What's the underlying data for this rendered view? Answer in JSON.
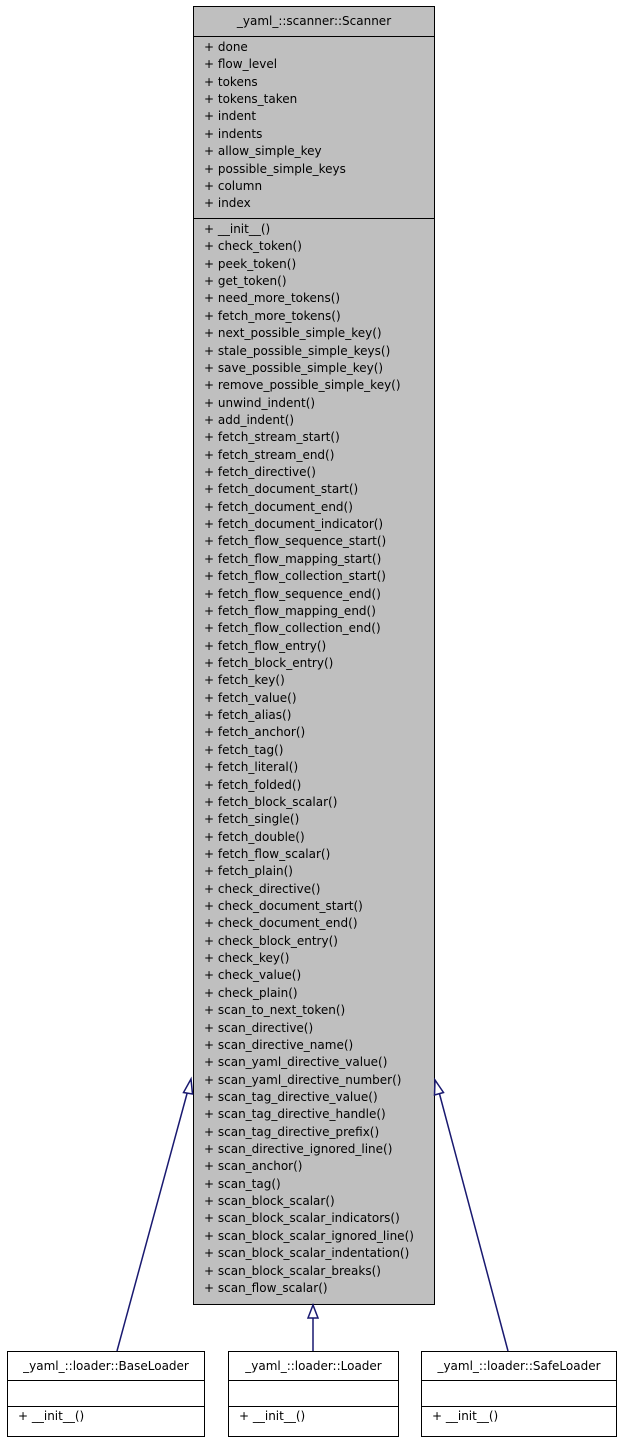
{
  "diagram": {
    "type": "uml-class-inheritance",
    "base_class": {
      "name": "_yaml_::scanner::Scanner",
      "attributes": [
        "+ done",
        "+ flow_level",
        "+ tokens",
        "+ tokens_taken",
        "+ indent",
        "+ indents",
        "+ allow_simple_key",
        "+ possible_simple_keys",
        "+ column",
        "+ index"
      ],
      "methods": [
        "+ __init__()",
        "+ check_token()",
        "+ peek_token()",
        "+ get_token()",
        "+ need_more_tokens()",
        "+ fetch_more_tokens()",
        "+ next_possible_simple_key()",
        "+ stale_possible_simple_keys()",
        "+ save_possible_simple_key()",
        "+ remove_possible_simple_key()",
        "+ unwind_indent()",
        "+ add_indent()",
        "+ fetch_stream_start()",
        "+ fetch_stream_end()",
        "+ fetch_directive()",
        "+ fetch_document_start()",
        "+ fetch_document_end()",
        "+ fetch_document_indicator()",
        "+ fetch_flow_sequence_start()",
        "+ fetch_flow_mapping_start()",
        "+ fetch_flow_collection_start()",
        "+ fetch_flow_sequence_end()",
        "+ fetch_flow_mapping_end()",
        "+ fetch_flow_collection_end()",
        "+ fetch_flow_entry()",
        "+ fetch_block_entry()",
        "+ fetch_key()",
        "+ fetch_value()",
        "+ fetch_alias()",
        "+ fetch_anchor()",
        "+ fetch_tag()",
        "+ fetch_literal()",
        "+ fetch_folded()",
        "+ fetch_block_scalar()",
        "+ fetch_single()",
        "+ fetch_double()",
        "+ fetch_flow_scalar()",
        "+ fetch_plain()",
        "+ check_directive()",
        "+ check_document_start()",
        "+ check_document_end()",
        "+ check_block_entry()",
        "+ check_key()",
        "+ check_value()",
        "+ check_plain()",
        "+ scan_to_next_token()",
        "+ scan_directive()",
        "+ scan_directive_name()",
        "+ scan_yaml_directive_value()",
        "+ scan_yaml_directive_number()",
        "+ scan_tag_directive_value()",
        "+ scan_tag_directive_handle()",
        "+ scan_tag_directive_prefix()",
        "+ scan_directive_ignored_line()",
        "+ scan_anchor()",
        "+ scan_tag()",
        "+ scan_block_scalar()",
        "+ scan_block_scalar_indicators()",
        "+ scan_block_scalar_ignored_line()",
        "+ scan_block_scalar_indentation()",
        "+ scan_block_scalar_breaks()",
        "+ scan_flow_scalar()"
      ]
    },
    "subclasses": [
      {
        "name": "_yaml_::loader::BaseLoader",
        "methods": [
          "+ __init__()"
        ]
      },
      {
        "name": "_yaml_::loader::Loader",
        "methods": [
          "+ __init__()"
        ]
      },
      {
        "name": "_yaml_::loader::SafeLoader",
        "methods": [
          "+ __init__()"
        ]
      }
    ],
    "colors": {
      "base_fill": "#bfbfbf",
      "sub_fill": "#ffffff",
      "border": "#000000",
      "edge": "#191970"
    }
  }
}
